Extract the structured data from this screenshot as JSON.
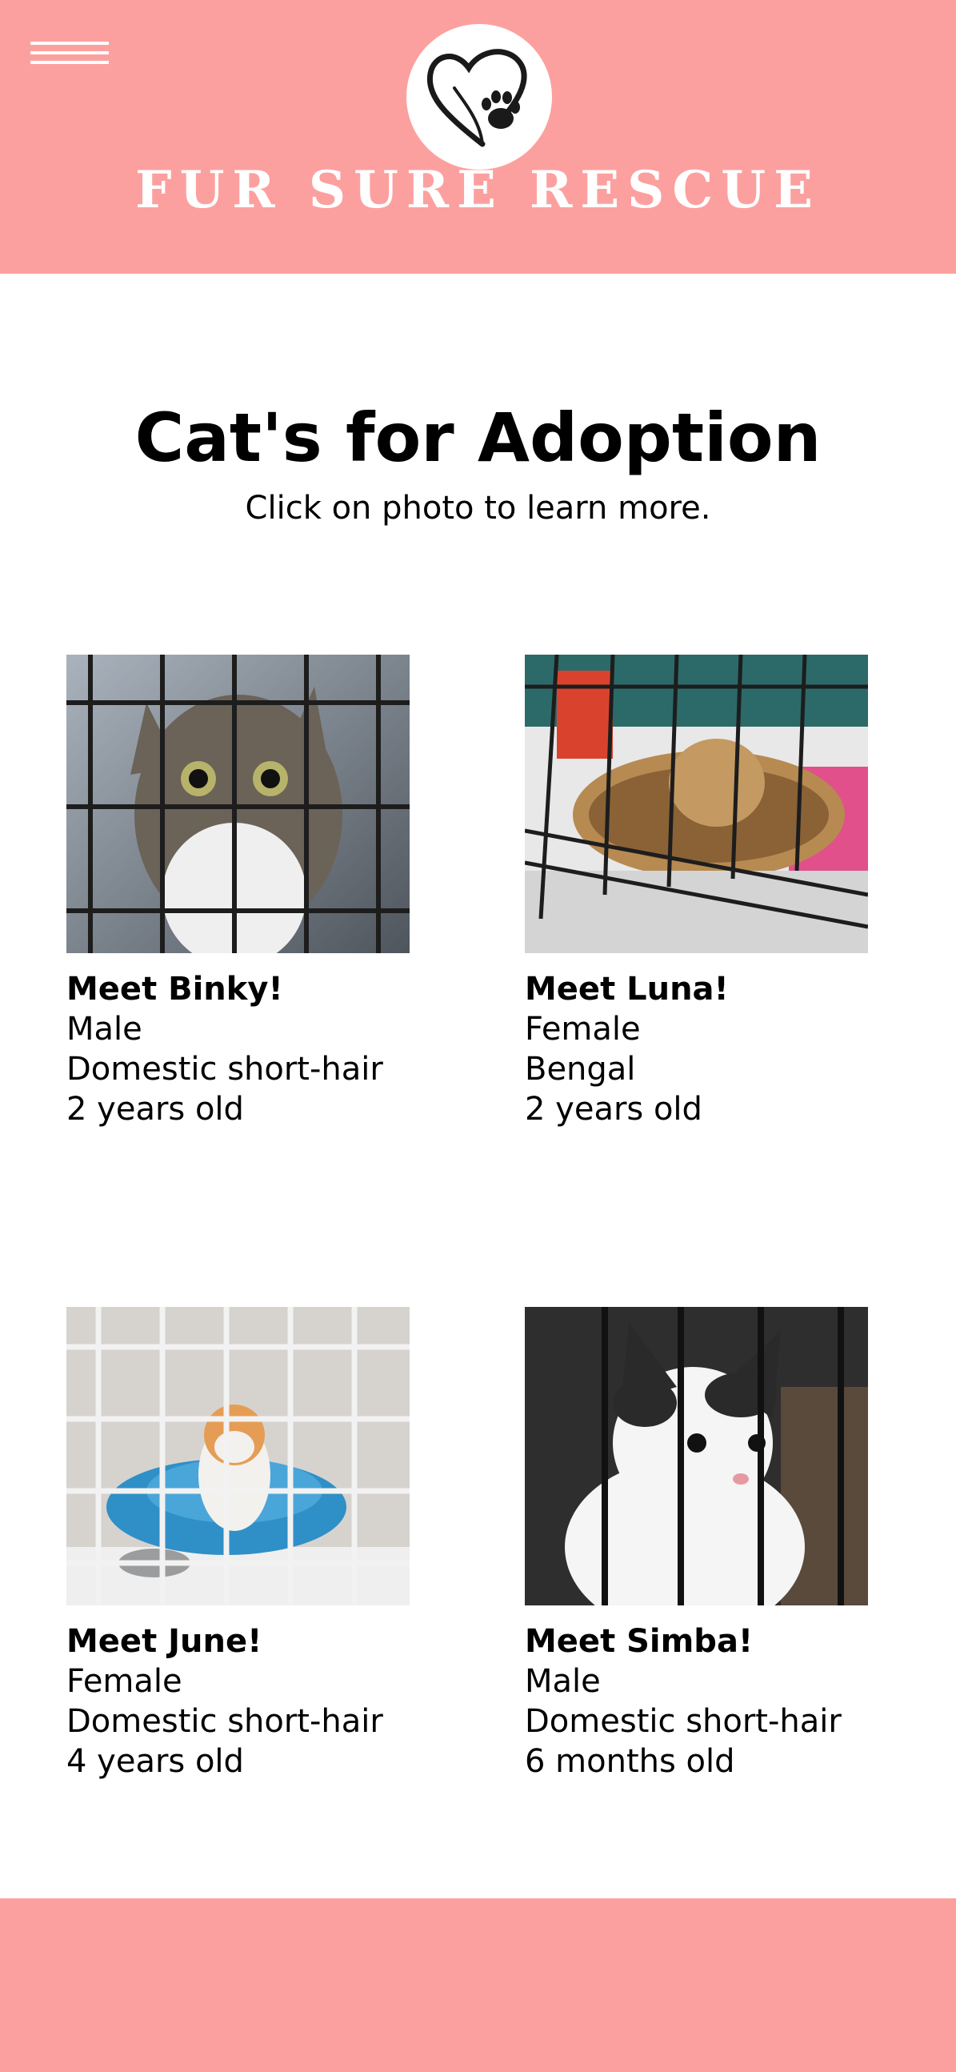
{
  "header": {
    "brand": "Fur Sure Rescue",
    "menu_icon": "hamburger-menu-icon",
    "logo_icon": "heart-paw-logo-icon",
    "background_color": "#fca09f"
  },
  "main": {
    "title": "Cat's for Adoption",
    "subtitle": "Click on photo to learn more."
  },
  "cats": [
    {
      "name": "Meet Binky!",
      "sex": "Male",
      "breed": "Domestic short-hair",
      "age": "2 years old"
    },
    {
      "name": "Meet Luna!",
      "sex": "Female",
      "breed": "Bengal",
      "age": "2 years old"
    },
    {
      "name": "Meet June!",
      "sex": "Female",
      "breed": "Domestic short-hair",
      "age": "4 years old"
    },
    {
      "name": "Meet Simba!",
      "sex": "Male",
      "breed": "Domestic short-hair",
      "age": "6 months old"
    }
  ],
  "footer": {
    "background_color": "#fca09f"
  }
}
